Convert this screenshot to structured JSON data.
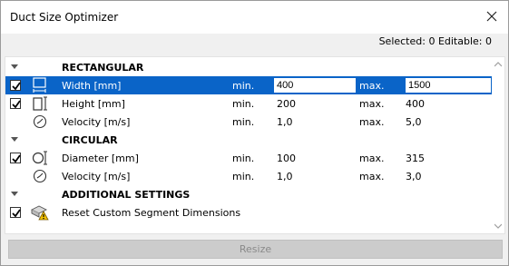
{
  "window": {
    "title": "Duct Size Optimizer"
  },
  "info": {
    "selected_editable": "Selected: 0 Editable: 0"
  },
  "sections": {
    "rectangular": "RECTANGULAR",
    "circular": "CIRCULAR",
    "additional": "ADDITIONAL SETTINGS"
  },
  "rows": {
    "width": {
      "label": "Width [mm]",
      "min_label": "min.",
      "min": "400",
      "max_label": "max.",
      "max": "1500",
      "checked": true,
      "icon": "width-icon"
    },
    "height": {
      "label": "Height [mm]",
      "min_label": "min.",
      "min": "200",
      "max_label": "max.",
      "max": "400",
      "checked": true,
      "icon": "height-icon"
    },
    "velocity_rect": {
      "label": "Velocity [m/s]",
      "min_label": "min.",
      "min": "1,0",
      "max_label": "max.",
      "max": "5,0",
      "icon": "gauge-icon"
    },
    "diameter": {
      "label": "Diameter [mm]",
      "min_label": "min.",
      "min": "100",
      "max_label": "max.",
      "max": "315",
      "checked": true,
      "icon": "diameter-icon"
    },
    "velocity_circ": {
      "label": "Velocity [m/s]",
      "min_label": "min.",
      "min": "1,0",
      "max_label": "max.",
      "max": "3,0",
      "icon": "gauge-icon"
    },
    "reset": {
      "label": "Reset Custom Segment Dimensions",
      "checked": true,
      "icon": "segment-warning-icon"
    }
  },
  "buttons": {
    "resize": "Resize"
  },
  "colors": {
    "selection": "#0a64c8",
    "disabled_button": "#cccccc"
  }
}
